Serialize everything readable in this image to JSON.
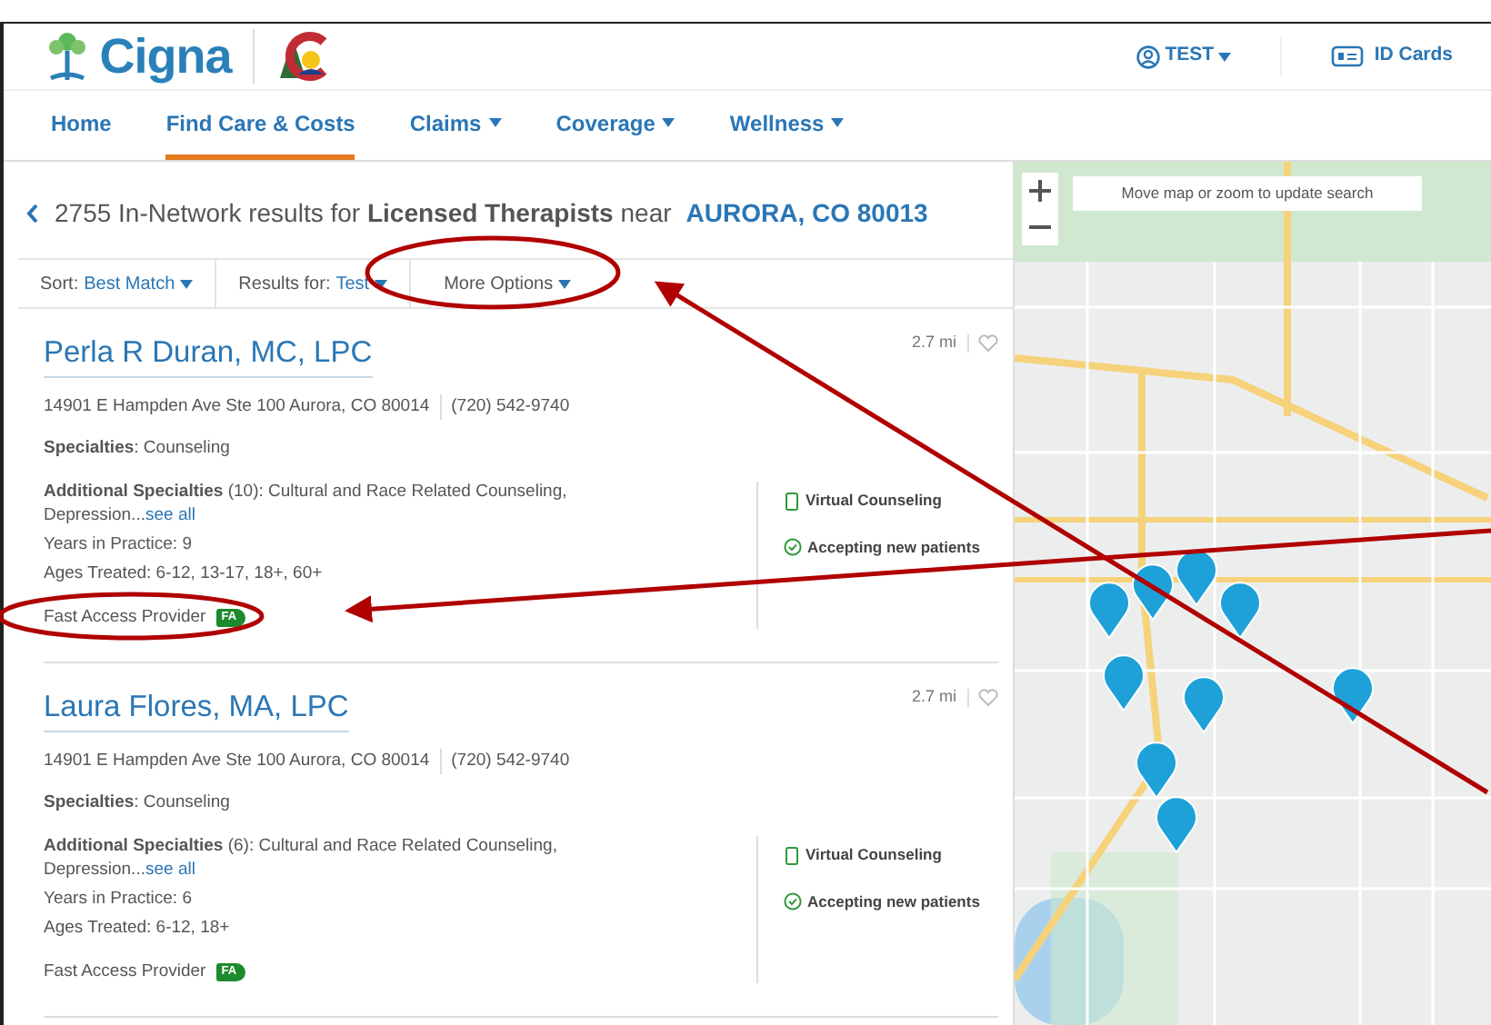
{
  "header": {
    "brand": "Cigna",
    "user_menu": "TEST",
    "id_cards": "ID Cards"
  },
  "nav": [
    {
      "label": "Home",
      "selected": false,
      "has_menu": false
    },
    {
      "label": "Find Care & Costs",
      "selected": true,
      "has_menu": false
    },
    {
      "label": "Claims",
      "selected": false,
      "has_menu": true
    },
    {
      "label": "Coverage",
      "selected": false,
      "has_menu": true
    },
    {
      "label": "Wellness",
      "selected": false,
      "has_menu": true
    }
  ],
  "results": {
    "summary": "2755 In-Network results for **Licensed Therapists** near",
    "location": "AURORA, CO 80013"
  },
  "filters": [
    {
      "label": "Sort:",
      "value": "Best Match"
    },
    {
      "label": "Results for:",
      "value": "Test"
    },
    {
      "label": "More Options"
    }
  ],
  "providers": [
    {
      "name": "Perla R Duran, MC, LPC",
      "distance": "2.7 mi",
      "address": "14901 E Hampden Ave Ste 100 Aurora, CO 80014",
      "phone": "(720) 542-9740",
      "specialties": "**Specialties**: Counseling",
      "additional": "**Additional Specialties** (10): Cultural and Race Related Counseling, Depression...",
      "see_all": "see all",
      "years": "Years in Practice: 9",
      "ages": "Ages Treated: 6-12, 13-17, 18+, 60+",
      "fast_access": "Fast Access Provider",
      "badge": "FA",
      "features": [
        {
          "kind": "virtual",
          "text": "Virtual Counseling"
        },
        {
          "kind": "accepting",
          "text": "Accepting new patients"
        }
      ]
    },
    {
      "name": "Laura Flores, MA, LPC",
      "distance": "2.7 mi",
      "address": "14901 E Hampden Ave Ste 100 Aurora, CO 80014",
      "phone": "(720) 542-9740",
      "specialties": "**Specialties**: Counseling",
      "additional": "**Additional Specialties** (6): Cultural and Race Related Counseling, Depression...",
      "see_all": "see all",
      "years": "Years in Practice: 6",
      "ages": "Ages Treated: 6-12, 18+",
      "fast_access": "Fast Access Provider",
      "badge": "FA",
      "features": [
        {
          "kind": "virtual",
          "text": "Virtual Counseling"
        },
        {
          "kind": "accepting",
          "text": "Accepting new patients"
        }
      ]
    }
  ],
  "map": {
    "hint": "Move map or zoom to update search"
  }
}
